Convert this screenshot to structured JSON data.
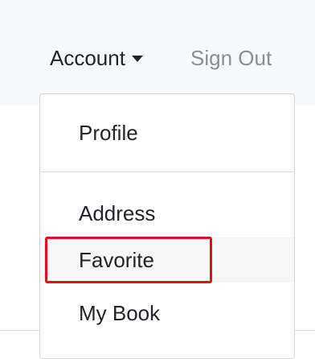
{
  "navbar": {
    "account_label": "Account",
    "signout_label": "Sign Out"
  },
  "dropdown": {
    "items": [
      {
        "label": "Profile"
      },
      {
        "label": "Address"
      },
      {
        "label": "Favorite"
      },
      {
        "label": "My Book"
      }
    ]
  },
  "colors": {
    "navbar_bg": "#f8f9fa",
    "text": "#212529",
    "muted_text": "#8a8f94",
    "highlight_border": "#e3101c"
  }
}
